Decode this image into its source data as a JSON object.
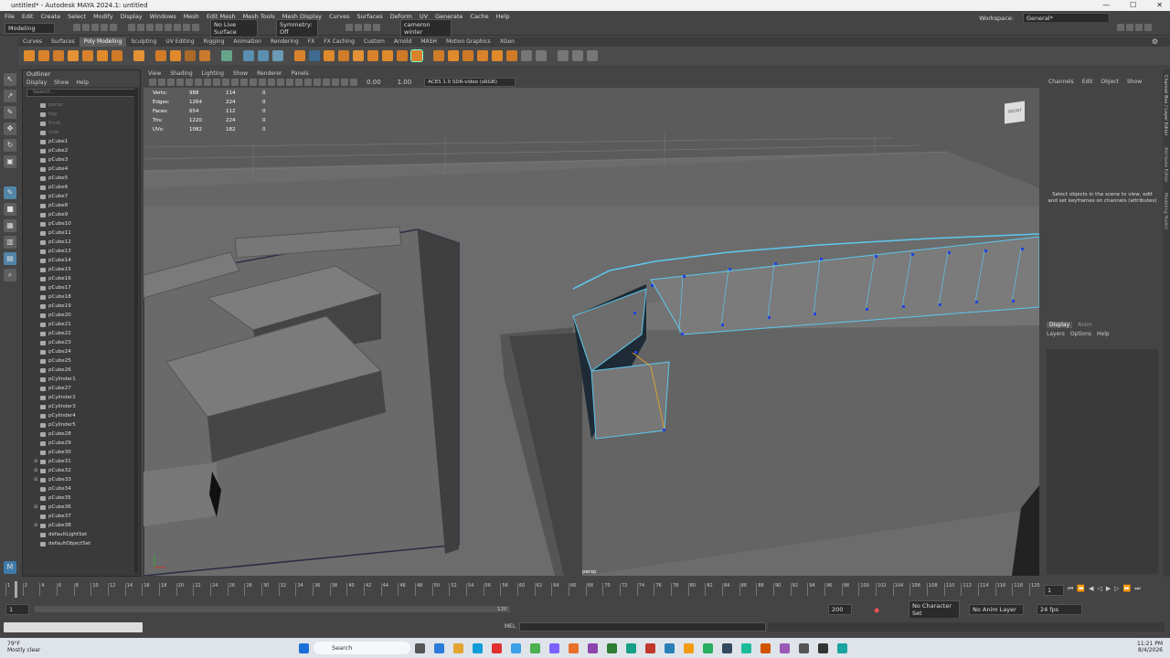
{
  "window": {
    "title": "untitled* - Autodesk MAYA 2024.1: untitled",
    "controls": [
      "—",
      "☐",
      "✕"
    ]
  },
  "menus": [
    "File",
    "Edit",
    "Create",
    "Select",
    "Modify",
    "Display",
    "Windows",
    "Mesh",
    "Edit Mesh",
    "Mesh Tools",
    "Mesh Display",
    "Curves",
    "Surfaces",
    "Deform",
    "UV",
    "Generate",
    "Cache",
    "Help"
  ],
  "workspace": {
    "label": "Workspace:",
    "value": "General*"
  },
  "status": {
    "mode": "Modeling",
    "live_surface": "No Live Surface",
    "symmetry": "Symmetry: Off",
    "user": "cameron winter"
  },
  "shelf_tabs": [
    "Curves",
    "Surfaces",
    "Poly Modeling",
    "Sculpting",
    "UV Editing",
    "Rigging",
    "Animation",
    "Rendering",
    "FX",
    "FX Caching",
    "Custom",
    "Arnold",
    "MASH",
    "Motion Graphics",
    "XGen"
  ],
  "shelf_active": "Poly Modeling",
  "outliner": {
    "title": "Outliner",
    "menu": [
      "Display",
      "Show",
      "Help"
    ],
    "search_placeholder": "Search...",
    "items": [
      "persp",
      "top",
      "front",
      "side",
      "pCube1",
      "pCube2",
      "pCube3",
      "pCube4",
      "pCube5",
      "pCube6",
      "pCube7",
      "pCube8",
      "pCube9",
      "pCube10",
      "pCube11",
      "pCube12",
      "pCube13",
      "pCube14",
      "pCube15",
      "pCube16",
      "pCube17",
      "pCube18",
      "pCube19",
      "pCube20",
      "pCube21",
      "pCube22",
      "pCube23",
      "pCube24",
      "pCube25",
      "pCube26",
      "pCylinder1",
      "pCube27",
      "pCylinder2",
      "pCylinder3",
      "pCylinder4",
      "pCylinder5",
      "pCube28",
      "pCube29",
      "pCube30",
      "pCube31",
      "pCube32",
      "pCube33",
      "pCube34",
      "pCube35",
      "pCube36",
      "pCube37",
      "pCube38",
      "defaultLightSet",
      "defaultObjectSet"
    ]
  },
  "viewport": {
    "menu": [
      "View",
      "Shading",
      "Lighting",
      "Show",
      "Renderer",
      "Panels"
    ],
    "exposure": "0.00",
    "gamma": "1.00",
    "colorspace": "ACES 1.0 SDR-video (sRGB)",
    "camera": "persp",
    "viewcube": "FRONT",
    "hud": [
      [
        "Verts:",
        "988",
        "114",
        "0"
      ],
      [
        "Edges:",
        "1264",
        "224",
        "0"
      ],
      [
        "Faces:",
        "654",
        "112",
        "0"
      ],
      [
        "Tris:",
        "1220",
        "224",
        "0"
      ],
      [
        "UVs:",
        "1082",
        "182",
        "0"
      ]
    ]
  },
  "channel_box": {
    "menu": [
      "Channels",
      "Edit",
      "Object",
      "Show"
    ],
    "message": "Select objects in the scene to view, edit and set keyframes on channels (attributes)",
    "layer_tabs": [
      "Display",
      "Anim"
    ],
    "layer_menu": [
      "Layers",
      "Options",
      "Help"
    ]
  },
  "side_tabs": [
    "Channel Box / Layer Editor",
    "Attribute Editor",
    "Modeling Toolkit"
  ],
  "timeline": {
    "ticks": [
      "1",
      "2",
      "4",
      "6",
      "8",
      "10",
      "12",
      "14",
      "16",
      "18",
      "20",
      "22",
      "24",
      "26",
      "28",
      "30",
      "32",
      "34",
      "36",
      "38",
      "40",
      "42",
      "44",
      "46",
      "48",
      "50",
      "52",
      "54",
      "56",
      "58",
      "60",
      "62",
      "64",
      "66",
      "68",
      "70",
      "72",
      "74",
      "76",
      "78",
      "80",
      "82",
      "84",
      "86",
      "88",
      "90",
      "92",
      "94",
      "96",
      "98",
      "100",
      "102",
      "104",
      "106",
      "108",
      "110",
      "112",
      "114",
      "116",
      "118",
      "120"
    ],
    "current": "1"
  },
  "range": {
    "start": "1",
    "inner_start": "1",
    "inner_end": "120",
    "end": "200",
    "char_set": "No Character Set",
    "anim_layer": "No Anim Layer",
    "fps": "24 fps"
  },
  "cmd": {
    "label": "MEL"
  },
  "taskbar": {
    "weather_temp": "79°F",
    "weather_desc": "Mostly clear",
    "search": "Search",
    "time": "11:21 PM",
    "date": "8/4/2026"
  }
}
